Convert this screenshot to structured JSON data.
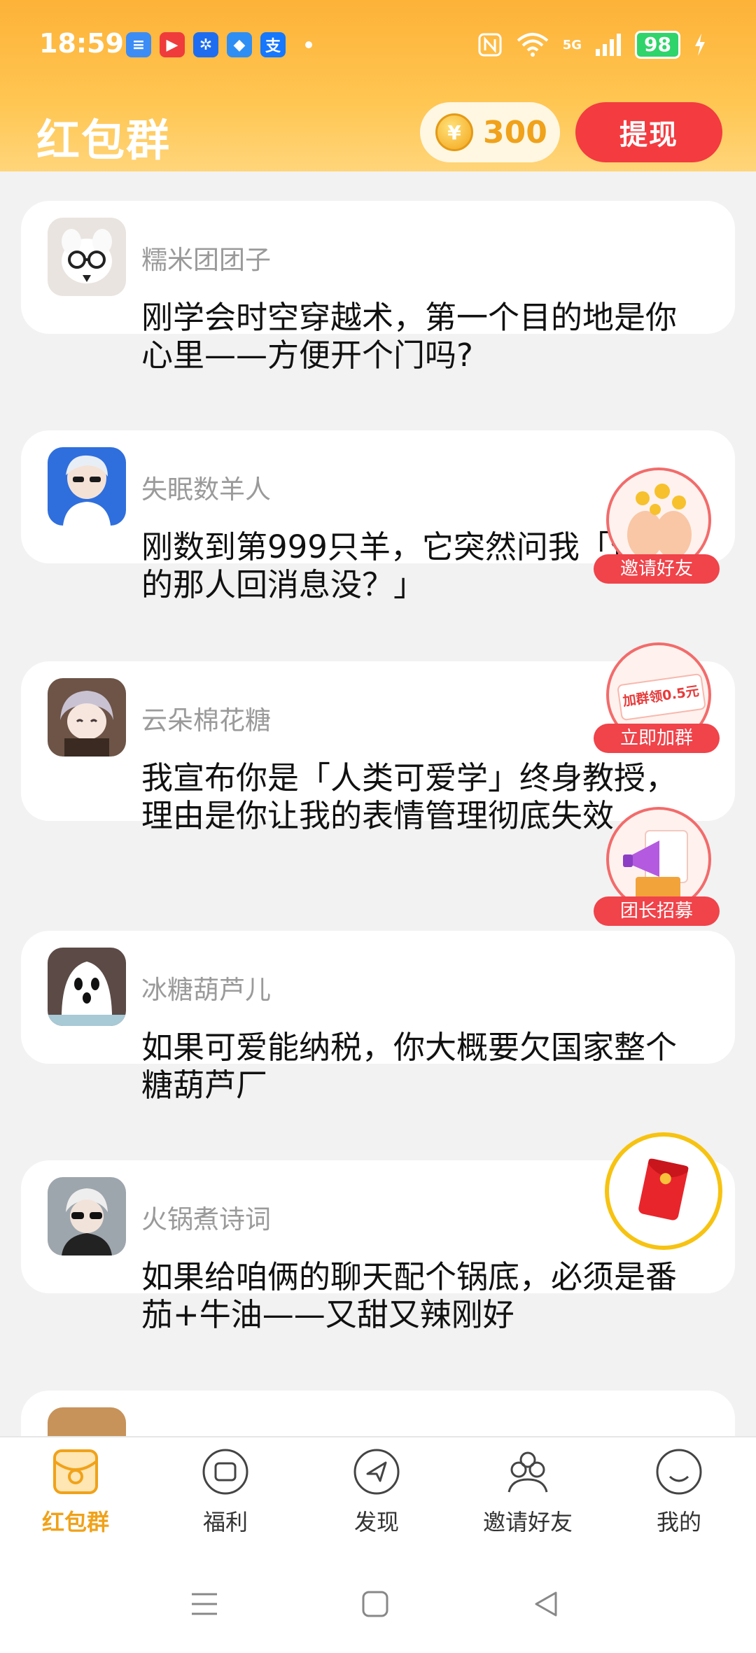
{
  "status_bar": {
    "time": "18:59",
    "network": "5G",
    "battery": "98",
    "notification_icons": [
      {
        "name": "message-app-icon",
        "glyph": "≡",
        "color": "#ffffff",
        "bg": "#3c8cf5"
      },
      {
        "name": "video-app-icon",
        "glyph": "▶",
        "color": "#ffffff",
        "bg": "#ef3b3b"
      },
      {
        "name": "pinwheel-app-icon",
        "glyph": "✲",
        "color": "#ffffff",
        "bg": "#1e6df0"
      },
      {
        "name": "browser-app-icon",
        "glyph": "◆",
        "color": "#ffffff",
        "bg": "#2f8ef4"
      },
      {
        "name": "alipay-app-icon",
        "glyph": "支",
        "color": "#ffffff",
        "bg": "#1677ff"
      }
    ]
  },
  "header": {
    "title": "红包群",
    "coin_balance": "300",
    "coin_symbol": "¥",
    "withdraw_label": "提现"
  },
  "posts": [
    {
      "name": "糯米团团子",
      "message": "刚学会时空穿越术，第一个目的地是你心里——方便开个门吗?"
    },
    {
      "name": "失眠数羊人",
      "message": "刚数到第999只羊，它突然问我「你等的那人回消息没？」"
    },
    {
      "name": "云朵棉花糖",
      "message": "我宣布你是「人类可爱学」终身教授，理由是你让我的表情管理彻底失效"
    },
    {
      "name": "冰糖葫芦儿",
      "message": "如果可爱能纳税，你大概要欠国家整个糖葫芦厂"
    },
    {
      "name": "火锅煮诗词",
      "message": "如果给咱俩的聊天配个锅底，必须是番茄+牛油——又甜又辣刚好"
    }
  ],
  "float_widgets": {
    "invite_label": "邀请好友",
    "join_label": "立即加群",
    "join_badge": "加群领0.5元",
    "recruit_label": "团长招募"
  },
  "bottom_nav": [
    {
      "label": "红包群",
      "icon": "red-packet-icon",
      "active": true
    },
    {
      "label": "福利",
      "icon": "welfare-icon",
      "active": false
    },
    {
      "label": "发现",
      "icon": "discover-icon",
      "active": false
    },
    {
      "label": "邀请好友",
      "icon": "invite-friends-icon",
      "active": false
    },
    {
      "label": "我的",
      "icon": "profile-icon",
      "active": false
    }
  ],
  "colors": {
    "header_orange": "#fdb238",
    "accent_red": "#f33b40",
    "active_tab": "#f0a21a"
  }
}
